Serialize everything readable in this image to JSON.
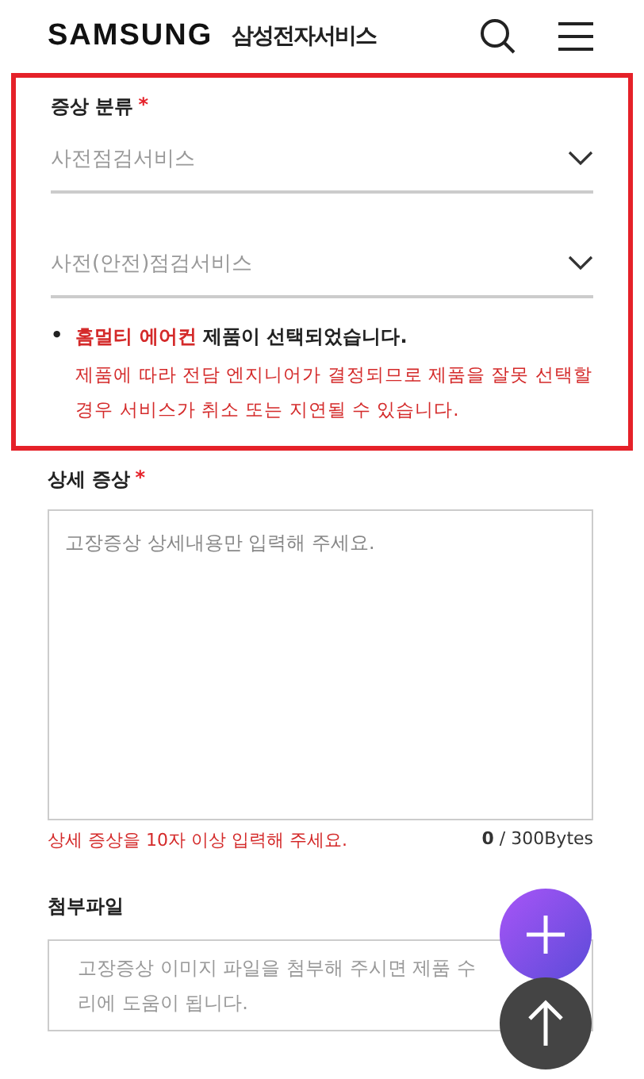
{
  "header": {
    "logo": "SAMSUNG",
    "title": "삼성전자서비스"
  },
  "symptom_category": {
    "label": "증상 분류",
    "required_mark": "*",
    "selects": [
      {
        "value": "사전점검서비스"
      },
      {
        "value": "사전(안전)점검서비스"
      }
    ],
    "notice": {
      "bullet": "•",
      "product": "홈멀티 에어컨",
      "message": "제품이 선택되었습니다.",
      "detail": "제품에 따라 전담 엔지니어가 결정되므로 제품을 잘못 선택할 경우 서비스가 취소 또는 지연될 수 있습니다."
    }
  },
  "symptom_detail": {
    "label": "상세 증상",
    "required_mark": "*",
    "placeholder": "고장증상 상세내용만 입력해 주세요.",
    "error": "상세 증상을 10자 이상 입력해 주세요.",
    "count": "0",
    "limit": " / 300Bytes"
  },
  "attachment": {
    "label": "첨부파일",
    "placeholder": "고장증상 이미지 파일을 첨부해 주시면 제품 수리에 도움이 됩니다."
  },
  "fabs": [
    {
      "kind": "plus"
    },
    {
      "kind": "up"
    }
  ]
}
